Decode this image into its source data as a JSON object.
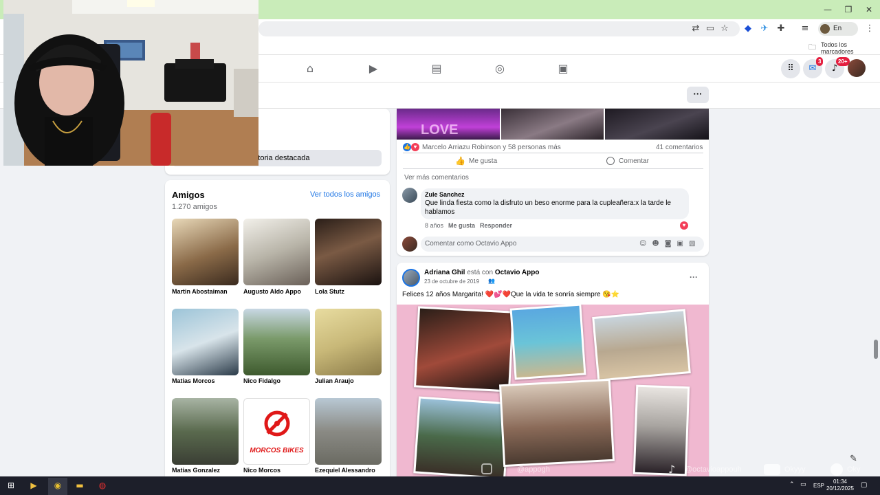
{
  "browser": {
    "profile_status": "En pausa",
    "bookmarks_all": "Todos los marcadores",
    "notifications_badge": "20+",
    "messenger_badge": "3"
  },
  "intro": {
    "featured_story_button": "r historia destacada"
  },
  "friends": {
    "title": "Amigos",
    "count": "1.270 amigos",
    "see_all": "Ver todos los amigos",
    "list": [
      {
        "name": "Martin Abostaiman"
      },
      {
        "name": "Augusto Aldo Appo"
      },
      {
        "name": "Lola Stutz"
      },
      {
        "name": "Matias Morcos"
      },
      {
        "name": "Nico Fidalgo"
      },
      {
        "name": "Julian Araujo"
      },
      {
        "name": "Matias Gonzalez"
      },
      {
        "name": "Nico Morcos"
      },
      {
        "name": "Ezequiel Alessandro"
      }
    ],
    "logo_text": "MORCOS BIKES"
  },
  "post1": {
    "reactions_text": "Marcelo Arriazu Robinson y 58 personas más",
    "comments_count": "41 comentarios",
    "like_label": "Me gusta",
    "comment_label": "Comentar",
    "see_more_comments": "Ver más comentarios",
    "comment": {
      "author": "Zule Sanchez",
      "text": "Que linda fiesta como la disfruto un beso enorme para la cupleañera:x la tarde le hablamos",
      "age": "8 años",
      "like": "Me gusta",
      "reply": "Responder"
    },
    "write_placeholder": "Comentar como Octavio Appo",
    "photo_text": "LOVE"
  },
  "post2": {
    "author": "Adriana Ghil",
    "with_word": "está con",
    "tagged": "Octavio Appo",
    "date": "23 de octubre de 2019",
    "text": "Felices 12 años Margarita! ❤️💕❤️Que la vida te sonría siempre 😘⭐"
  },
  "overlay": {
    "social_1": "@appogh",
    "social_2": "@octavioappouh",
    "social_3": "Okyyy",
    "social_4": "Oky"
  },
  "taskbar": {
    "lang": "ESP",
    "time": "01:34",
    "date": "20/12/2025"
  },
  "colors": {
    "fb_blue": "#1b74e4",
    "title_bar": "#c9ecb9",
    "badge_red": "#e41e3f"
  }
}
